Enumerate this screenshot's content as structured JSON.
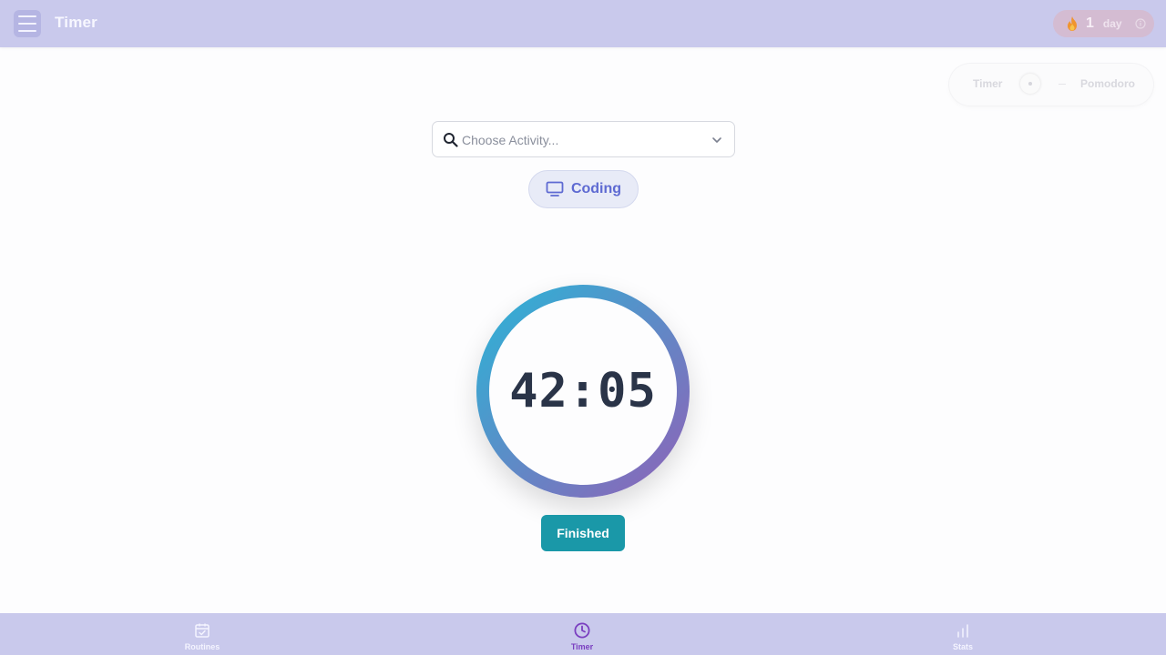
{
  "header": {
    "title": "Timer",
    "streak": {
      "count": "1",
      "unit": "day"
    }
  },
  "mode_toggle": {
    "options": [
      "Timer",
      "Pomodoro"
    ]
  },
  "activity": {
    "placeholder": "Choose Activity...",
    "selected": "Coding"
  },
  "timer": {
    "display": "42:05",
    "ring_colors": [
      "#2db3d6",
      "#8e63b8"
    ]
  },
  "actions": {
    "finished_label": "Finished"
  },
  "nav": {
    "items": [
      {
        "label": "Routines",
        "icon": "calendar-check-icon"
      },
      {
        "label": "Timer",
        "icon": "clock-icon",
        "active": true
      },
      {
        "label": "Stats",
        "icon": "bar-chart-icon"
      }
    ]
  },
  "colors": {
    "bar_bg": "#c9c9ec",
    "accent": "#5e6ad2",
    "finished_bg": "#1a98a8",
    "active_nav": "#7a3fc0"
  }
}
